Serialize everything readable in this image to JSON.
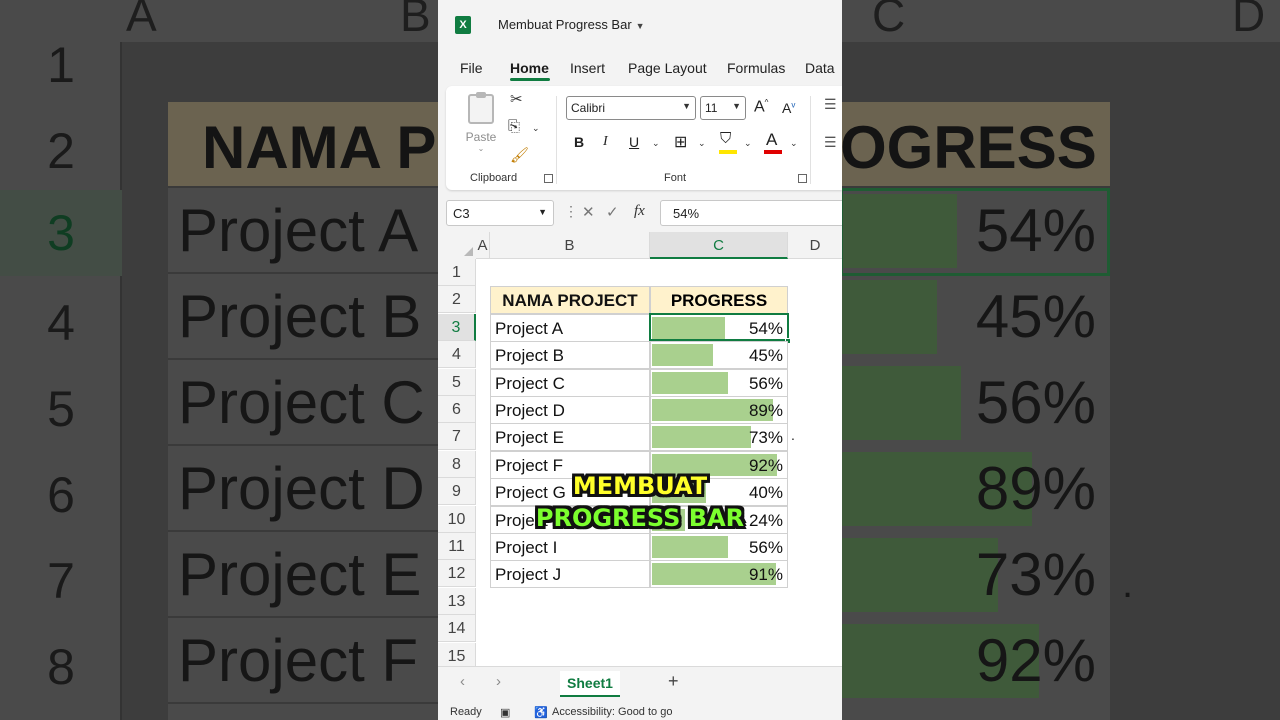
{
  "window": {
    "doc_title": "Membuat Progress Bar",
    "app_icon": "excel-icon"
  },
  "tabs": [
    "File",
    "Home",
    "Insert",
    "Page Layout",
    "Formulas",
    "Data"
  ],
  "active_tab": "Home",
  "ribbon": {
    "clipboard": {
      "paste_label": "Paste",
      "group_label": "Clipboard",
      "icons": [
        "cut-icon",
        "copy-icon",
        "format-painter-icon"
      ]
    },
    "font": {
      "font_name": "Calibri",
      "font_size": "11",
      "group_label": "Font",
      "bold": "B",
      "italic": "I",
      "underline": "U",
      "grow_icon": "A",
      "shrink_icon": "A",
      "font_color_icon": "A",
      "fill_color": "#ffe600",
      "font_color": "#e00000"
    }
  },
  "formula_bar": {
    "name_box": "C3",
    "fx_label": "fx",
    "value": "54%"
  },
  "grid": {
    "columns": [
      "A",
      "B",
      "C",
      "D"
    ],
    "selected_column": "C",
    "rows": [
      "1",
      "2",
      "3",
      "4",
      "5",
      "6",
      "7",
      "8",
      "9",
      "10",
      "11",
      "12",
      "13",
      "14",
      "15"
    ],
    "selected_row": "3",
    "headers": {
      "name": "NAMA PROJECT",
      "progress": "PROGRESS"
    },
    "projects": [
      {
        "name": "Project A",
        "pct_label": "54%",
        "progress": 0.54
      },
      {
        "name": "Project B",
        "pct_label": "45%",
        "progress": 0.45
      },
      {
        "name": "Project C",
        "pct_label": "56%",
        "progress": 0.56
      },
      {
        "name": "Project D",
        "pct_label": "89%",
        "progress": 0.89
      },
      {
        "name": "Project E",
        "pct_label": "73%",
        "progress": 0.73
      },
      {
        "name": "Project F",
        "pct_label": "92%",
        "progress": 0.92
      },
      {
        "name": "Project G",
        "pct_label": "40%",
        "progress": 0.4
      },
      {
        "name": "Project H",
        "pct_label": "24%",
        "progress": 0.24
      },
      {
        "name": "Project I",
        "pct_label": "56%",
        "progress": 0.56
      },
      {
        "name": "Project J",
        "pct_label": "91%",
        "progress": 0.91
      }
    ],
    "header_fill": "#fff2cc",
    "bar_color": "#a9d08e"
  },
  "overlay": {
    "line1": "MEMBUAT",
    "line2": "PROGRESS BAR"
  },
  "sheets": {
    "active": "Sheet1",
    "add_label": "+"
  },
  "status": {
    "ready": "Ready",
    "accessibility": "Accessibility: Good to go"
  },
  "background": {
    "col_labels": [
      "A",
      "B",
      "C",
      "D"
    ],
    "row_labels": [
      "1",
      "2",
      "3",
      "4",
      "5",
      "6",
      "7",
      "8"
    ],
    "header_fragment_left": "NAMA P",
    "header_fragment_right": "OGRESS",
    "rows": [
      {
        "name": "Project A",
        "pct_label": "54%",
        "progress": 0.54
      },
      {
        "name": "Project B",
        "pct_label": "45%",
        "progress": 0.45
      },
      {
        "name": "Project C",
        "pct_label": "56%",
        "progress": 0.56
      },
      {
        "name": "Project D",
        "pct_label": "89%",
        "progress": 0.89
      },
      {
        "name": "Project E",
        "pct_label": "73%",
        "progress": 0.73
      },
      {
        "name": "Project F",
        "pct_label": "92%",
        "progress": 0.92
      }
    ]
  }
}
